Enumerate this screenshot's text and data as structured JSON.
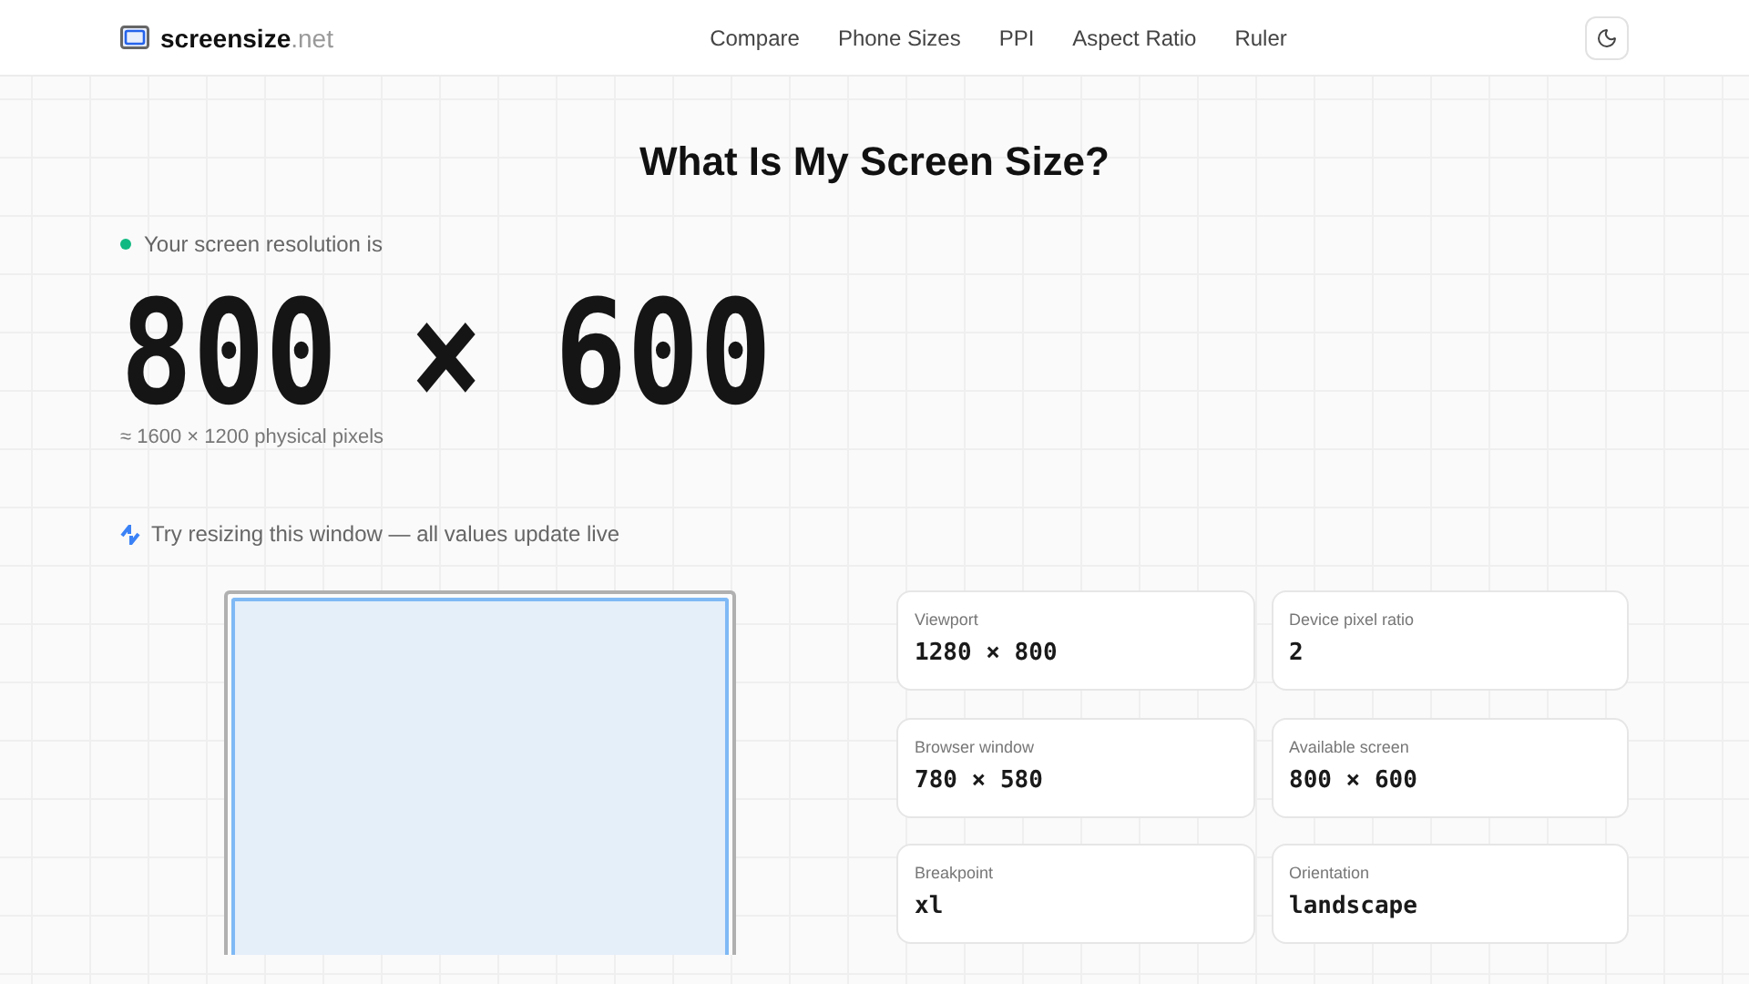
{
  "header": {
    "logo": {
      "name": "screensize",
      "suffix": ".net"
    },
    "nav": [
      {
        "label": "Compare"
      },
      {
        "label": "Phone Sizes"
      },
      {
        "label": "PPI"
      },
      {
        "label": "Aspect Ratio"
      },
      {
        "label": "Ruler"
      }
    ]
  },
  "title": "What Is My Screen Size?",
  "status": {
    "label": "Your screen resolution is",
    "color": "#10b981"
  },
  "resolution": "800 × 600",
  "physical": "≈ 1600 × 1200 physical pixels",
  "hint": "Try resizing this window — all values update live",
  "stats": [
    {
      "label": "Viewport",
      "value": "1280 × 800"
    },
    {
      "label": "Device pixel ratio",
      "value": "2"
    },
    {
      "label": "Browser window",
      "value": "780 × 580"
    },
    {
      "label": "Available screen",
      "value": "800 × 600"
    },
    {
      "label": "Breakpoint",
      "value": "xl"
    },
    {
      "label": "Orientation",
      "value": "landscape"
    }
  ]
}
